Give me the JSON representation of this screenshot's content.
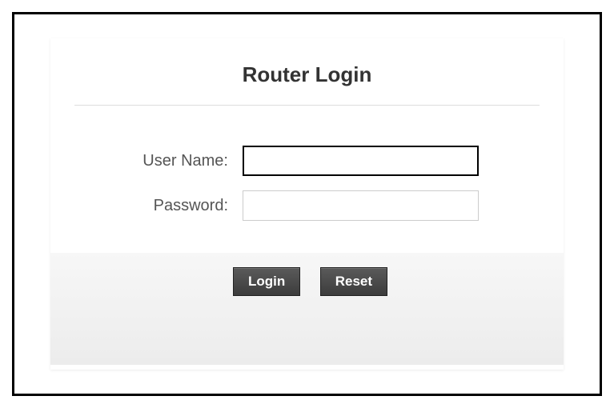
{
  "header": {
    "title": "Router Login"
  },
  "form": {
    "username_label": "User Name:",
    "username_value": "",
    "password_label": "Password:",
    "password_value": ""
  },
  "buttons": {
    "login_label": "Login",
    "reset_label": "Reset"
  }
}
